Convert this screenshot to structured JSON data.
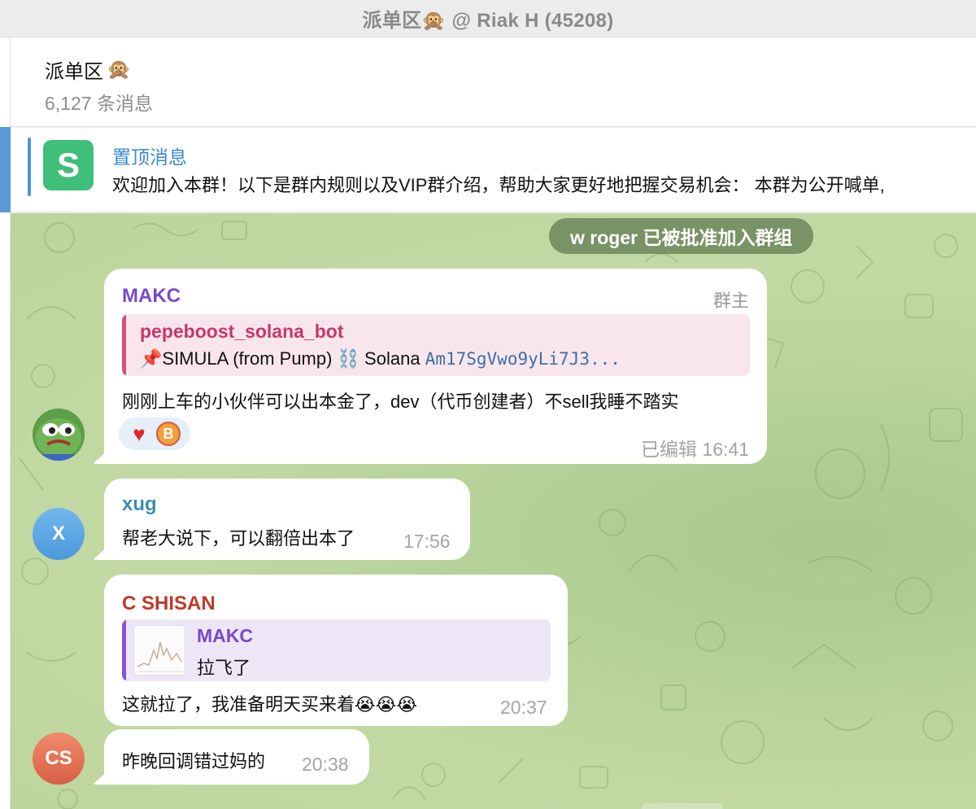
{
  "window": {
    "title": "派单区🙊 @ Riak H (45208)"
  },
  "header": {
    "title": "派单区",
    "title_emoji": "🙊",
    "subtitle": "6,127 条消息"
  },
  "pinned": {
    "label": "置顶消息",
    "text": "欢迎加入本群！以下是群内规则以及VIP群介绍，帮助大家更好地把握交易机会：  本群为公开喊单,",
    "thumb_glyph": "S",
    "thumb_color": "#3fbf7a"
  },
  "service": {
    "text": "w roger 已被批准加入群组"
  },
  "messages": [
    {
      "sender": "MAKC",
      "sender_color": "#7a48c8",
      "role": "群主",
      "quote": {
        "name": "pepeboost_solana_bot",
        "text_pre": "📌SIMULA (from Pump) ⛓️ Solana ",
        "text_code": "Am17SgVwo9yLi7J3..."
      },
      "text": "刚刚上车的小伙伴可以出本金了，dev（代币创建者）不sell我睡不踏实",
      "reactions": [
        "heart",
        "bitcoin"
      ],
      "meta": "已编辑 16:41"
    },
    {
      "sender": "xug",
      "sender_color": "#3a8fb0",
      "text": "帮老大说下，可以翻倍出本了",
      "meta": "17:56",
      "avatar_initial": "X"
    },
    {
      "sender": "C SHISAN",
      "sender_color": "#c0392b",
      "quote": {
        "name": "MAKC",
        "text": "拉飞了"
      },
      "text": "这就拉了，我准备明天买来着😭😭😭",
      "meta": "20:37"
    },
    {
      "text": "昨晚回调错过妈的",
      "meta": "20:38",
      "avatar_initial": "CS"
    }
  ],
  "colors": {
    "chat_bg": "#b7d39a",
    "accent": "#3a8ad4"
  }
}
